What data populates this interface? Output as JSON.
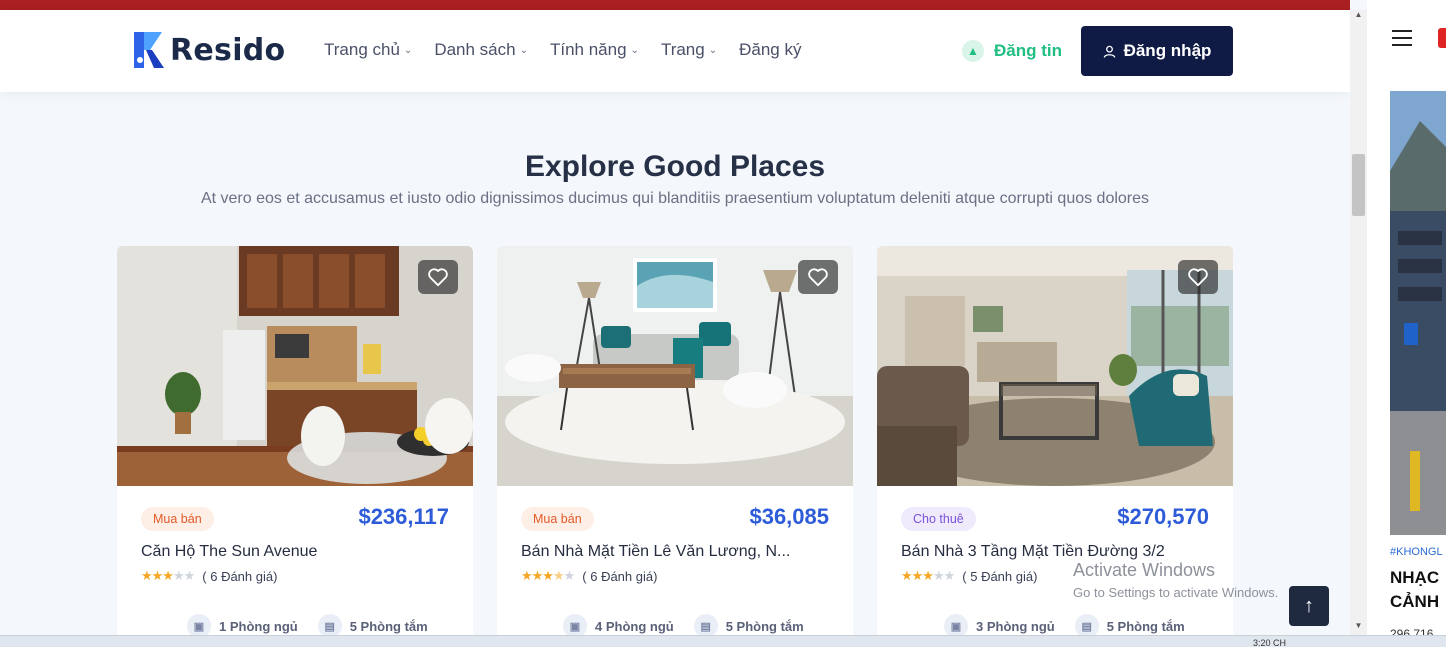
{
  "brand": {
    "name": "Resido"
  },
  "nav": [
    {
      "label": "Trang chủ",
      "has_dropdown": true
    },
    {
      "label": "Danh sách",
      "has_dropdown": true
    },
    {
      "label": "Tính năng",
      "has_dropdown": true
    },
    {
      "label": "Trang",
      "has_dropdown": true
    },
    {
      "label": "Đăng ký",
      "has_dropdown": false
    }
  ],
  "header": {
    "post_label": "Đăng tin",
    "login_label": "Đăng nhập"
  },
  "section": {
    "title": "Explore Good Places",
    "subtitle": "At vero eos et accusamus et iusto odio dignissimos ducimus qui blanditiis praesentium voluptatum deleniti atque corrupti quos dolores"
  },
  "listings": [
    {
      "badge": "Mua bán",
      "badge_type": "sale",
      "price": "$236,117",
      "title": "Căn Hộ The Sun Avenue",
      "stars": 3,
      "reviews": "( 6 Đánh giá)",
      "bedrooms": "1 Phòng ngủ",
      "bathrooms": "5 Phòng tắm"
    },
    {
      "badge": "Mua bán",
      "badge_type": "sale",
      "price": "$36,085",
      "title": "Bán Nhà Mặt Tiền Lê Văn Lương, N...",
      "stars": 3.5,
      "reviews": "( 6 Đánh giá)",
      "bedrooms": "4 Phòng ngủ",
      "bathrooms": "5 Phòng tắm"
    },
    {
      "badge": "Cho thuê",
      "badge_type": "rent",
      "price": "$270,570",
      "title": "Bán Nhà 3 Tầng Mặt Tiền Đường 3/2",
      "stars": 3,
      "reviews": "( 5 Đánh giá)",
      "bedrooms": "3 Phòng ngủ",
      "bathrooms": "5 Phòng tắm"
    }
  ],
  "watermark": {
    "title": "Activate Windows",
    "subtitle": "Go to Settings to activate Windows."
  },
  "side_panel": {
    "tag": "#KHONGL",
    "title_line1": "NHẠC",
    "title_line2": "CẢNH",
    "views": "296,716"
  },
  "taskbar": {
    "time": "3:20 CH"
  },
  "colors": {
    "accent_blue": "#2e5cd8",
    "navy": "#0f1a45",
    "green": "#1fbf82",
    "top_bar": "#a91f22"
  }
}
